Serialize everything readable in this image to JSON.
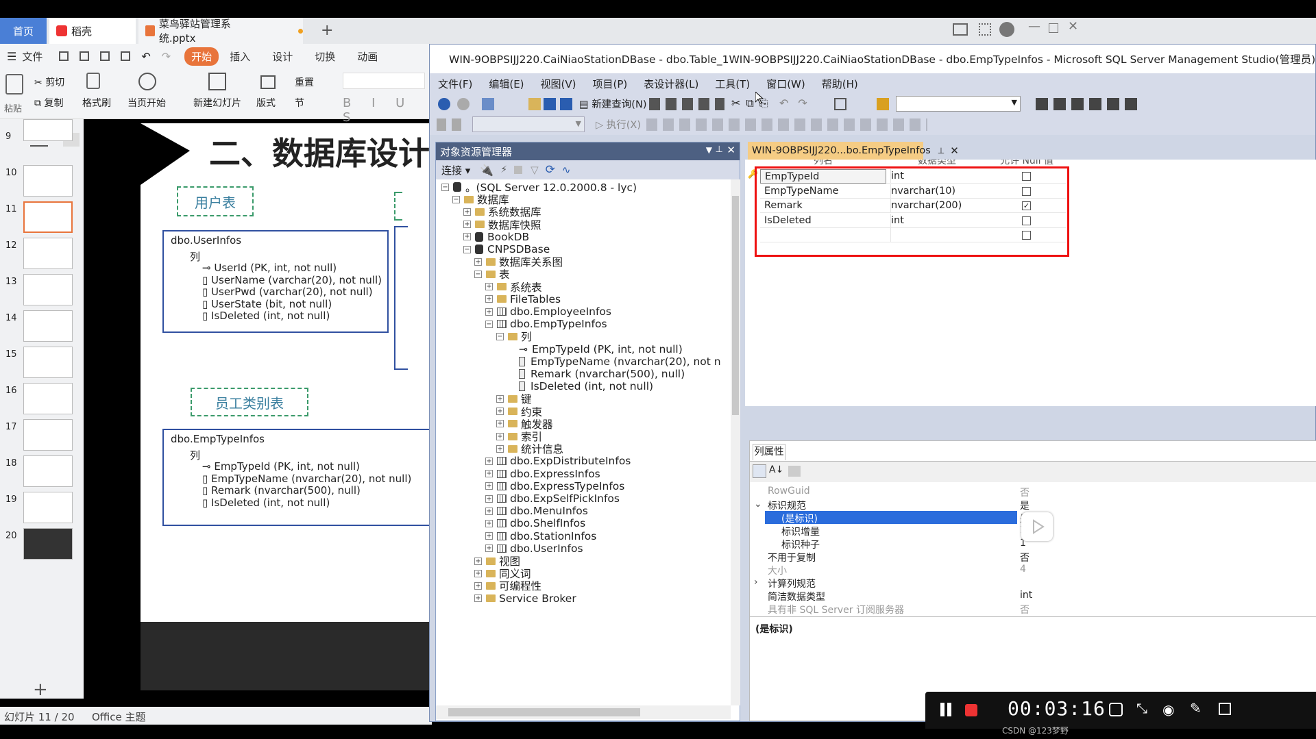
{
  "wps": {
    "tabs": [
      "首页",
      "稻壳",
      "菜鸟驿站管理系统.pptx"
    ],
    "menu": [
      "文件",
      "开始",
      "插入",
      "设计",
      "切换",
      "动画"
    ],
    "toolbar": [
      "粘贴",
      "剪切",
      "复制",
      "格式刷",
      "当页开始",
      "新建幻灯片",
      "版式",
      "节",
      "重置"
    ],
    "thumbs": [
      "9",
      "10",
      "11",
      "12",
      "13",
      "14",
      "15",
      "16",
      "17",
      "18",
      "19",
      "20"
    ],
    "slide_title": "二、数据库设计",
    "user_label": "用户表",
    "user_table": "dbo.UserInfos",
    "user_col_folder": "列",
    "user_cols": [
      "UserId (PK, int, not null)",
      "UserName (varchar(20), not null)",
      "UserPwd (varchar(20), not null)",
      "UserState (bit, not null)",
      "IsDeleted (int, not null)"
    ],
    "emp_label": "员工类别表",
    "emp_table": "dbo.EmpTypeInfos",
    "emp_col_folder": "列",
    "emp_cols": [
      "EmpTypeId (PK, int, not null)",
      "EmpTypeName (nvarchar(20), not null)",
      "Remark (nvarchar(500), null)",
      "IsDeleted (int, not null)"
    ],
    "status_slide": "幻灯片 11 / 20",
    "status_theme": "Office 主题"
  },
  "ssms": {
    "title": "WIN-9OBPSIJJ220.CaiNiaoStationDBase - dbo.Table_1WIN-9OBPSIJJ220.CaiNiaoStationDBase - dbo.EmpTypeInfos - Microsoft SQL Server Management Studio(管理员)",
    "menu": [
      "文件(F)",
      "编辑(E)",
      "视图(V)",
      "项目(P)",
      "表设计器(L)",
      "工具(T)",
      "窗口(W)",
      "帮助(H)"
    ],
    "new_query": "新建查询(N)",
    "execute": "执行(X)",
    "oe_title": "对象资源管理器",
    "connect": "连接",
    "tree": [
      {
        "t": "。(SQL Server 12.0.2000.8 - lyc)",
        "l": 0,
        "i": "server"
      },
      {
        "t": "数据库",
        "l": 1,
        "i": "folder"
      },
      {
        "t": "系统数据库",
        "l": 2,
        "i": "folder"
      },
      {
        "t": "数据库快照",
        "l": 2,
        "i": "folder"
      },
      {
        "t": "BookDB",
        "l": 2,
        "i": "db"
      },
      {
        "t": "CNPSDBase",
        "l": 2,
        "i": "db"
      },
      {
        "t": "数据库关系图",
        "l": 3,
        "i": "folder"
      },
      {
        "t": "表",
        "l": 3,
        "i": "folder"
      },
      {
        "t": "系统表",
        "l": 4,
        "i": "folder"
      },
      {
        "t": "FileTables",
        "l": 4,
        "i": "folder"
      },
      {
        "t": "dbo.EmployeeInfos",
        "l": 4,
        "i": "table"
      },
      {
        "t": "dbo.EmpTypeInfos",
        "l": 4,
        "i": "table"
      },
      {
        "t": "列",
        "l": 5,
        "i": "folder"
      },
      {
        "t": "EmpTypeId (PK, int, not null)",
        "l": 6,
        "i": "key"
      },
      {
        "t": "EmpTypeName (nvarchar(20), not n",
        "l": 6,
        "i": "col"
      },
      {
        "t": "Remark (nvarchar(500), null)",
        "l": 6,
        "i": "col"
      },
      {
        "t": "IsDeleted (int, not null)",
        "l": 6,
        "i": "col"
      },
      {
        "t": "键",
        "l": 5,
        "i": "folder"
      },
      {
        "t": "约束",
        "l": 5,
        "i": "folder"
      },
      {
        "t": "触发器",
        "l": 5,
        "i": "folder"
      },
      {
        "t": "索引",
        "l": 5,
        "i": "folder"
      },
      {
        "t": "统计信息",
        "l": 5,
        "i": "folder"
      },
      {
        "t": "dbo.ExpDistributeInfos",
        "l": 4,
        "i": "table"
      },
      {
        "t": "dbo.ExpressInfos",
        "l": 4,
        "i": "table"
      },
      {
        "t": "dbo.ExpressTypeInfos",
        "l": 4,
        "i": "table"
      },
      {
        "t": "dbo.ExpSelfPickInfos",
        "l": 4,
        "i": "table"
      },
      {
        "t": "dbo.MenuInfos",
        "l": 4,
        "i": "table"
      },
      {
        "t": "dbo.ShelfInfos",
        "l": 4,
        "i": "table"
      },
      {
        "t": "dbo.StationInfos",
        "l": 4,
        "i": "table"
      },
      {
        "t": "dbo.UserInfos",
        "l": 4,
        "i": "table"
      },
      {
        "t": "视图",
        "l": 3,
        "i": "folder"
      },
      {
        "t": "同义词",
        "l": 3,
        "i": "folder"
      },
      {
        "t": "可编程性",
        "l": 3,
        "i": "folder"
      },
      {
        "t": "Service Broker",
        "l": 3,
        "i": "folder"
      }
    ],
    "doc_tab": "WIN-9OBPSIJJ220...bo.EmpTypeInfos",
    "grid_headers": [
      "列名",
      "数据类型",
      "允许 Null 值"
    ],
    "grid_rows": [
      {
        "name": "EmpTypeId",
        "type": "int",
        "null": false
      },
      {
        "name": "EmpTypeName",
        "type": "nvarchar(10)",
        "null": false
      },
      {
        "name": "Remark",
        "type": "nvarchar(200)",
        "null": true
      },
      {
        "name": "IsDeleted",
        "type": "int",
        "null": false
      },
      {
        "name": "",
        "type": "",
        "null": false
      }
    ],
    "props_title": "列属性",
    "props": [
      {
        "k": "RowGuid",
        "v": "否",
        "l": 0,
        "gray": true
      },
      {
        "k": "标识规范",
        "v": "是",
        "l": 0,
        "exp": "v"
      },
      {
        "k": "(是标识)",
        "v": "是",
        "l": 1,
        "sel": true
      },
      {
        "k": "标识增量",
        "v": "1",
        "l": 1
      },
      {
        "k": "标识种子",
        "v": "1",
        "l": 1
      },
      {
        "k": "不用于复制",
        "v": "否",
        "l": 0
      },
      {
        "k": "大小",
        "v": "4",
        "l": 0,
        "gray": true
      },
      {
        "k": "计算列规范",
        "v": "",
        "l": 0,
        "exp": ">"
      },
      {
        "k": "简洁数据类型",
        "v": "int",
        "l": 0
      },
      {
        "k": "具有非 SQL Server 订阅服务器",
        "v": "否",
        "l": 0,
        "gray": true
      }
    ],
    "props_desc": "(是标识)"
  },
  "recorder": {
    "time": "00:03:16",
    "watermark": "CSDN @123梦野"
  }
}
